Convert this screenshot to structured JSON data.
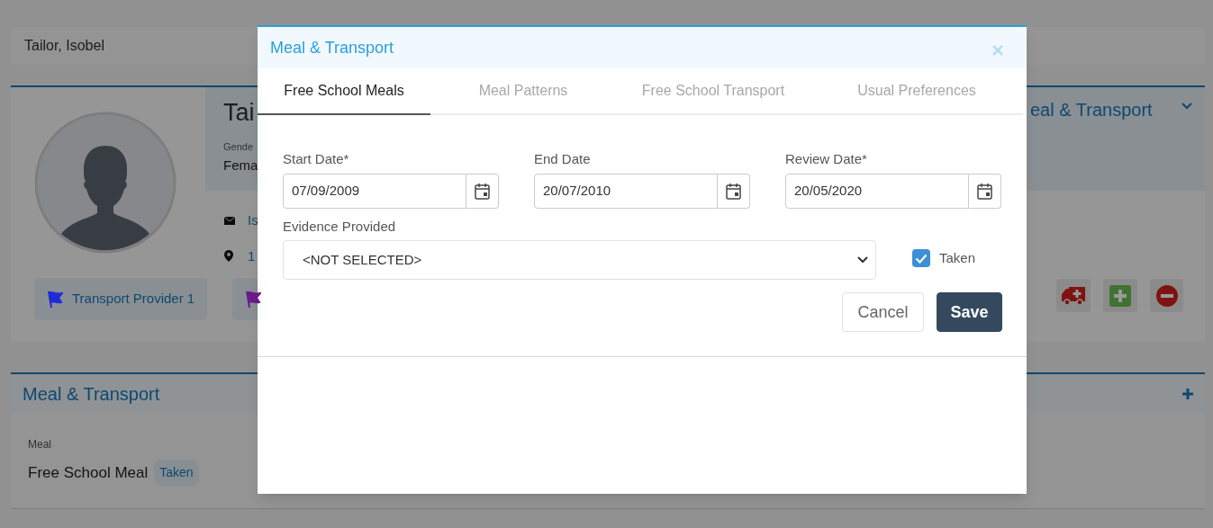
{
  "page": {
    "header": {
      "name": "Tailor, Isobel"
    },
    "profile": {
      "name": "Tai",
      "gender_label": "Gende",
      "gender_value": "Fema",
      "email": "Is",
      "address": "1",
      "section_title": "eal & Transport",
      "tags": [
        {
          "label": "Transport Provider 1",
          "color": "#1e2bd6"
        },
        {
          "color": "#6a1b8a"
        }
      ]
    },
    "meal_section": {
      "title": "Meal & Transport",
      "label": "Meal",
      "value": "Free School Meal",
      "status": "Taken"
    }
  },
  "modal": {
    "title": "Meal & Transport",
    "tabs": [
      {
        "label": "Free School Meals",
        "selected": true
      },
      {
        "label": "Meal Patterns",
        "selected": false
      },
      {
        "label": "Free School Transport",
        "selected": false
      },
      {
        "label": "Usual Preferences",
        "selected": false
      }
    ],
    "date_fields": [
      {
        "label": "Start Date*",
        "value": "07/09/2009"
      },
      {
        "label": "End Date",
        "value": "20/07/2010"
      },
      {
        "label": "Review Date*",
        "value": "20/05/2020"
      }
    ],
    "evidence": {
      "label": "Evidence Provided",
      "value": "<NOT SELECTED>"
    },
    "taken": {
      "label": "Taken",
      "checked": true
    },
    "buttons": [
      {
        "label": "Cancel",
        "kind": "secondary"
      },
      {
        "label": "Save",
        "kind": "primary"
      }
    ]
  }
}
